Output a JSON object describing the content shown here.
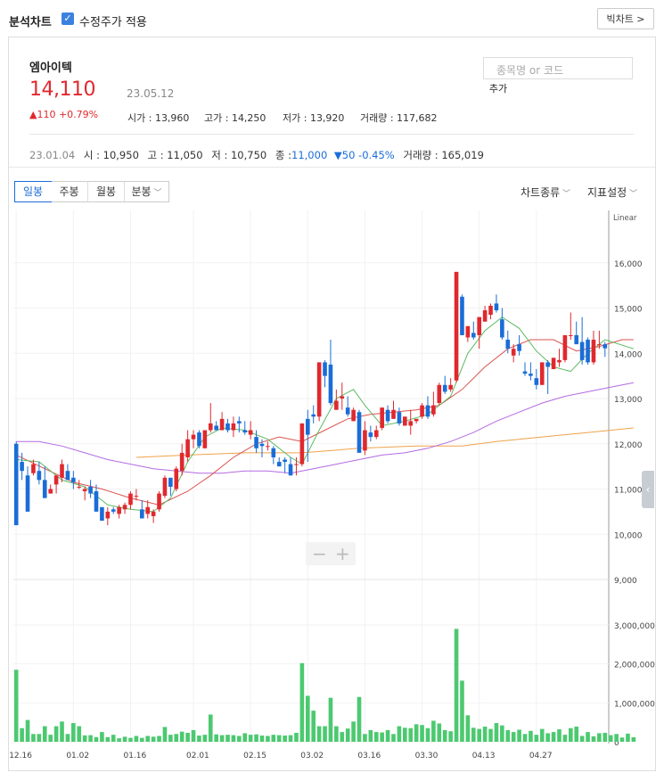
{
  "header": {
    "title": "분석차트",
    "adjusted_price_label": "수정주가 적용",
    "adjusted_price_checked": true,
    "big_chart_label": "빅차트 >"
  },
  "stock": {
    "name": "엠아이텍",
    "price": "14,110",
    "date": "23.05.12",
    "change": "▲110 +0.79%",
    "open_label": "시가 : 13,960",
    "high_label": "고가 : 14,250",
    "low_label": "저가 : 13,920",
    "volume_label": "거래량 : 117,682"
  },
  "search": {
    "placeholder": "종목명 or 코드",
    "add_label": "추가"
  },
  "hover_row": {
    "date": "23.01.04",
    "open": "시 : 10,950",
    "high": "고 : 11,050",
    "low": "저 : 10,750",
    "close_label": "종 :",
    "close_value": "11,000",
    "change": "▼50 -0.45%",
    "volume": "거래량 : 165,019"
  },
  "period_tabs": [
    "일봉",
    "주봉",
    "월봉",
    "분봉"
  ],
  "active_tab": "일봉",
  "menus": {
    "chart_type": "차트종류",
    "indicator": "지표설정"
  },
  "colors": {
    "up": "#e0282e",
    "down": "#1a6dd8",
    "ma5": "#5dbb63",
    "ma20": "#d9534f",
    "ma60": "#b36ae2",
    "ma120": "#f0a24a",
    "volume": "#4cc970"
  },
  "chart_data": [
    {
      "type": "candlestick",
      "scale_label": "Linear",
      "ylim": [
        9000,
        17000
      ],
      "y_ticks": [
        "16,000",
        "15,000",
        "14,000",
        "13,000",
        "12,000",
        "11,000",
        "10,000",
        "9,000"
      ],
      "x_ticks": [
        "12.16",
        "01.02",
        "01.16",
        "02.01",
        "02.15",
        "03.02",
        "03.16",
        "03.30",
        "04.13",
        "04.27"
      ],
      "candles": [
        [
          12000,
          12050,
          10200,
          10200
        ],
        [
          11600,
          11800,
          11200,
          11400
        ],
        [
          11300,
          11500,
          10500,
          10500
        ],
        [
          11350,
          11650,
          11300,
          11550
        ],
        [
          11400,
          11600,
          11100,
          11200
        ],
        [
          11200,
          11500,
          10800,
          10800
        ],
        [
          10900,
          11100,
          10900,
          11000
        ],
        [
          11100,
          11300,
          10900,
          11300
        ],
        [
          11250,
          11650,
          11150,
          11550
        ],
        [
          11400,
          11550,
          11200,
          11200
        ],
        [
          11250,
          11400,
          11000,
          11150
        ],
        [
          11050,
          11200,
          11000,
          11050
        ],
        [
          10950,
          11050,
          10750,
          11000
        ],
        [
          11050,
          11200,
          10800,
          10900
        ],
        [
          10950,
          11100,
          10500,
          10500
        ],
        [
          10600,
          10600,
          10300,
          10300
        ],
        [
          10350,
          10600,
          10200,
          10500
        ],
        [
          10550,
          10600,
          10450,
          10500
        ],
        [
          10450,
          10650,
          10350,
          10600
        ],
        [
          10550,
          10700,
          10450,
          10650
        ],
        [
          10650,
          10950,
          10550,
          10900
        ],
        [
          10850,
          11000,
          10750,
          10850
        ],
        [
          10550,
          10750,
          10350,
          10350
        ],
        [
          10450,
          10750,
          10350,
          10600
        ],
        [
          10400,
          10550,
          10250,
          10500
        ],
        [
          10550,
          10950,
          10500,
          10900
        ],
        [
          10850,
          11300,
          10800,
          11250
        ],
        [
          11250,
          11200,
          10850,
          11050
        ],
        [
          11000,
          11500,
          10950,
          11450
        ],
        [
          11400,
          12000,
          11300,
          11800
        ],
        [
          11700,
          12300,
          11600,
          12100
        ],
        [
          12100,
          12300,
          11900,
          12200
        ],
        [
          12250,
          12300,
          11900,
          11950
        ],
        [
          11900,
          12300,
          11900,
          12300
        ],
        [
          12300,
          12900,
          12250,
          12450
        ],
        [
          12400,
          12500,
          12300,
          12300
        ],
        [
          12300,
          12700,
          12300,
          12550
        ],
        [
          12450,
          12550,
          12250,
          12300
        ],
        [
          12300,
          12600,
          12150,
          12450
        ],
        [
          12500,
          12600,
          12250,
          12450
        ],
        [
          12300,
          12500,
          12200,
          12250
        ],
        [
          12200,
          12500,
          12100,
          12300
        ],
        [
          12150,
          12300,
          11800,
          11900
        ],
        [
          12000,
          12100,
          11700,
          11950
        ],
        [
          11950,
          12050,
          11850,
          11950
        ],
        [
          11900,
          11950,
          11550,
          11700
        ],
        [
          11600,
          11700,
          11500,
          11500
        ],
        [
          11650,
          11700,
          11350,
          11600
        ],
        [
          11550,
          11700,
          11300,
          11300
        ],
        [
          11550,
          11700,
          11300,
          11550
        ],
        [
          11550,
          12450,
          11500,
          12450
        ],
        [
          12550,
          12750,
          11600,
          12200
        ],
        [
          12650,
          12850,
          12450,
          12600
        ],
        [
          12600,
          13800,
          12500,
          13800
        ],
        [
          13800,
          13850,
          13250,
          13500
        ],
        [
          13750,
          14300,
          12850,
          12900
        ],
        [
          12750,
          13200,
          12750,
          12950
        ],
        [
          13000,
          13350,
          12750,
          13050
        ],
        [
          12800,
          13050,
          12600,
          12650
        ],
        [
          12500,
          12800,
          12550,
          12750
        ],
        [
          12700,
          12750,
          12250,
          11800
        ],
        [
          11850,
          12500,
          11750,
          12300
        ],
        [
          12250,
          12400,
          12050,
          12150
        ],
        [
          12150,
          12400,
          12100,
          12300
        ],
        [
          12350,
          12800,
          12300,
          12800
        ],
        [
          12750,
          12850,
          12450,
          12500
        ],
        [
          12550,
          12950,
          12550,
          12750
        ],
        [
          12700,
          12800,
          12400,
          12450
        ],
        [
          12400,
          12600,
          12400,
          12600
        ],
        [
          12400,
          12750,
          12200,
          12500
        ],
        [
          12500,
          12550,
          12450,
          12550
        ],
        [
          12600,
          12900,
          12550,
          12850
        ],
        [
          12850,
          13050,
          12550,
          12600
        ],
        [
          12650,
          13150,
          12600,
          12850
        ],
        [
          12900,
          13350,
          12850,
          13300
        ],
        [
          13300,
          13500,
          13100,
          13150
        ],
        [
          13200,
          13450,
          13150,
          13300
        ],
        [
          13400,
          15800,
          13350,
          15800
        ],
        [
          15250,
          15300,
          14400,
          14400
        ],
        [
          14350,
          14600,
          14250,
          14600
        ],
        [
          14450,
          14700,
          14300,
          14350
        ],
        [
          14400,
          14800,
          14100,
          14800
        ],
        [
          14700,
          15050,
          14700,
          14950
        ],
        [
          14850,
          15100,
          14750,
          15050
        ],
        [
          15100,
          15300,
          14900,
          14950
        ],
        [
          14750,
          15000,
          14300,
          14350
        ],
        [
          14300,
          14500,
          14000,
          14100
        ],
        [
          13950,
          14200,
          13800,
          14100
        ],
        [
          14200,
          14400,
          13950,
          14050
        ],
        [
          13600,
          13800,
          13500,
          13550
        ],
        [
          13550,
          13800,
          13400,
          13500
        ],
        [
          13450,
          13650,
          13200,
          13300
        ],
        [
          13300,
          13800,
          13300,
          13800
        ],
        [
          13800,
          13850,
          13100,
          13700
        ],
        [
          13650,
          13900,
          13650,
          13900
        ],
        [
          13800,
          14100,
          13700,
          13850
        ],
        [
          13850,
          14400,
          13800,
          14400
        ],
        [
          14400,
          14900,
          14300,
          14400
        ],
        [
          14400,
          14700,
          14200,
          14200
        ],
        [
          14250,
          14800,
          13750,
          13850
        ],
        [
          14300,
          14350,
          13750,
          13800
        ],
        [
          13800,
          14500,
          13750,
          14300
        ],
        [
          14200,
          14500,
          14100,
          14200
        ],
        [
          14200,
          14250,
          13920,
          14110
        ]
      ],
      "ma5": [
        [
          0,
          11650
        ],
        [
          4,
          11600
        ],
        [
          8,
          11200
        ],
        [
          12,
          11050
        ],
        [
          16,
          10650
        ],
        [
          20,
          10550
        ],
        [
          24,
          10500
        ],
        [
          27,
          10800
        ],
        [
          30,
          11600
        ],
        [
          33,
          12150
        ],
        [
          36,
          12350
        ],
        [
          40,
          12300
        ],
        [
          44,
          12100
        ],
        [
          48,
          11700
        ],
        [
          50,
          11550
        ],
        [
          53,
          12300
        ],
        [
          56,
          13000
        ],
        [
          59,
          13200
        ],
        [
          61,
          12850
        ],
        [
          64,
          12400
        ],
        [
          68,
          12500
        ],
        [
          72,
          12650
        ],
        [
          76,
          13050
        ],
        [
          79,
          14000
        ],
        [
          82,
          14500
        ],
        [
          85,
          14800
        ],
        [
          88,
          14550
        ],
        [
          91,
          14050
        ],
        [
          94,
          13700
        ],
        [
          97,
          13600
        ],
        [
          100,
          14000
        ],
        [
          103,
          14300
        ],
        [
          108,
          14100
        ]
      ],
      "ma20": [
        [
          0,
          11750
        ],
        [
          5,
          11450
        ],
        [
          10,
          11150
        ],
        [
          15,
          11000
        ],
        [
          20,
          10800
        ],
        [
          25,
          10650
        ],
        [
          30,
          10950
        ],
        [
          34,
          11300
        ],
        [
          38,
          11700
        ],
        [
          42,
          12000
        ],
        [
          46,
          12150
        ],
        [
          50,
          12050
        ],
        [
          54,
          12300
        ],
        [
          58,
          12550
        ],
        [
          62,
          12650
        ],
        [
          66,
          12700
        ],
        [
          70,
          12750
        ],
        [
          74,
          12850
        ],
        [
          78,
          13200
        ],
        [
          82,
          13700
        ],
        [
          86,
          14100
        ],
        [
          90,
          14300
        ],
        [
          94,
          14300
        ],
        [
          98,
          14050
        ],
        [
          102,
          14150
        ],
        [
          106,
          14300
        ],
        [
          108,
          14300
        ]
      ],
      "ma60": [
        [
          0,
          12050
        ],
        [
          4,
          12050
        ],
        [
          8,
          11950
        ],
        [
          12,
          11800
        ],
        [
          16,
          11650
        ],
        [
          20,
          11550
        ],
        [
          24,
          11450
        ],
        [
          28,
          11400
        ],
        [
          32,
          11350
        ],
        [
          36,
          11350
        ],
        [
          40,
          11400
        ],
        [
          44,
          11400
        ],
        [
          48,
          11350
        ],
        [
          52,
          11450
        ],
        [
          56,
          11550
        ],
        [
          60,
          11650
        ],
        [
          64,
          11750
        ],
        [
          68,
          11800
        ],
        [
          72,
          11900
        ],
        [
          76,
          12050
        ],
        [
          80,
          12250
        ],
        [
          84,
          12500
        ],
        [
          88,
          12700
        ],
        [
          92,
          12900
        ],
        [
          96,
          13050
        ],
        [
          100,
          13150
        ],
        [
          104,
          13250
        ],
        [
          108,
          13350
        ]
      ],
      "ma120": [
        [
          21,
          11700
        ],
        [
          30,
          11750
        ],
        [
          40,
          11800
        ],
        [
          50,
          11800
        ],
        [
          60,
          11900
        ],
        [
          70,
          11950
        ],
        [
          78,
          11950
        ],
        [
          84,
          12050
        ],
        [
          92,
          12150
        ],
        [
          100,
          12250
        ],
        [
          108,
          12350
        ]
      ]
    },
    {
      "type": "bar",
      "series_label": "volume",
      "ylim": [
        0,
        3000000
      ],
      "y_ticks": [
        "3,000,000",
        "2,000,000",
        "1,000,000",
        "0"
      ],
      "values": [
        1850000,
        350000,
        560000,
        200000,
        200000,
        400000,
        180000,
        400000,
        520000,
        200000,
        480000,
        400000,
        165019,
        170000,
        120000,
        250000,
        120000,
        180000,
        90000,
        130000,
        100000,
        150000,
        100000,
        150000,
        130000,
        150000,
        380000,
        180000,
        200000,
        260000,
        230000,
        300000,
        160000,
        180000,
        700000,
        190000,
        170000,
        180000,
        170000,
        150000,
        220000,
        180000,
        190000,
        160000,
        150000,
        180000,
        170000,
        160000,
        170000,
        230000,
        2020000,
        1180000,
        800000,
        400000,
        400000,
        1130000,
        400000,
        250000,
        340000,
        520000,
        1150000,
        200000,
        300000,
        250000,
        240000,
        300000,
        200000,
        400000,
        360000,
        350000,
        450000,
        430000,
        350000,
        540000,
        470000,
        300000,
        270000,
        2900000,
        1570000,
        680000,
        360000,
        330000,
        390000,
        330000,
        480000,
        420000,
        300000,
        250000,
        310000,
        200000,
        280000,
        180000,
        330000,
        220000,
        250000,
        320000,
        180000,
        350000,
        390000,
        150000,
        250000,
        140000,
        220000,
        230000,
        170000,
        200000,
        110000,
        210000,
        117682
      ]
    }
  ]
}
